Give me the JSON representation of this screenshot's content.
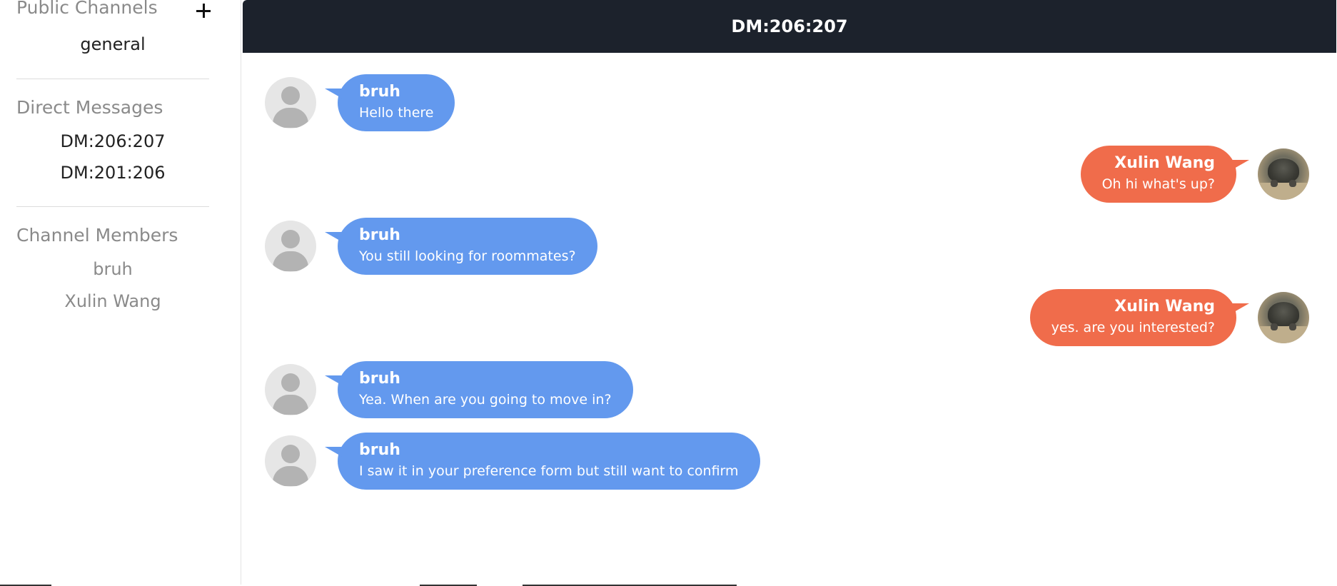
{
  "sidebar": {
    "public_channels": {
      "title": "Public Channels",
      "items": [
        {
          "label": "general"
        }
      ]
    },
    "direct_messages": {
      "title": "Direct Messages",
      "items": [
        {
          "label": "DM:206:207"
        },
        {
          "label": "DM:201:206"
        }
      ]
    },
    "channel_members": {
      "title": "Channel Members",
      "items": [
        {
          "label": "bruh"
        },
        {
          "label": "Xulin Wang"
        }
      ]
    },
    "add_icon": "plus-icon"
  },
  "header": {
    "title": "DM:206:207"
  },
  "colors": {
    "header_bg": "#1c222c",
    "incoming_bubble": "#6399ee",
    "outgoing_bubble": "#f06c4b",
    "muted_text": "#8a8a8a"
  },
  "messages": [
    {
      "side": "left",
      "sender": "bruh",
      "text": "Hello there",
      "avatar": "default-user-icon"
    },
    {
      "side": "right",
      "sender": "Xulin Wang",
      "text": "Oh hi what's up?",
      "avatar": "turtle-photo"
    },
    {
      "side": "left",
      "sender": "bruh",
      "text": "You still looking for roommates?",
      "avatar": "default-user-icon"
    },
    {
      "side": "right",
      "sender": "Xulin Wang",
      "text": "yes. are you interested?",
      "avatar": "turtle-photo"
    },
    {
      "side": "left",
      "sender": "bruh",
      "text": "Yea. When are you going to move in?",
      "avatar": "default-user-icon"
    },
    {
      "side": "left",
      "sender": "bruh",
      "text": "I saw it in your preference form but still want to confirm",
      "avatar": "default-user-icon"
    }
  ]
}
